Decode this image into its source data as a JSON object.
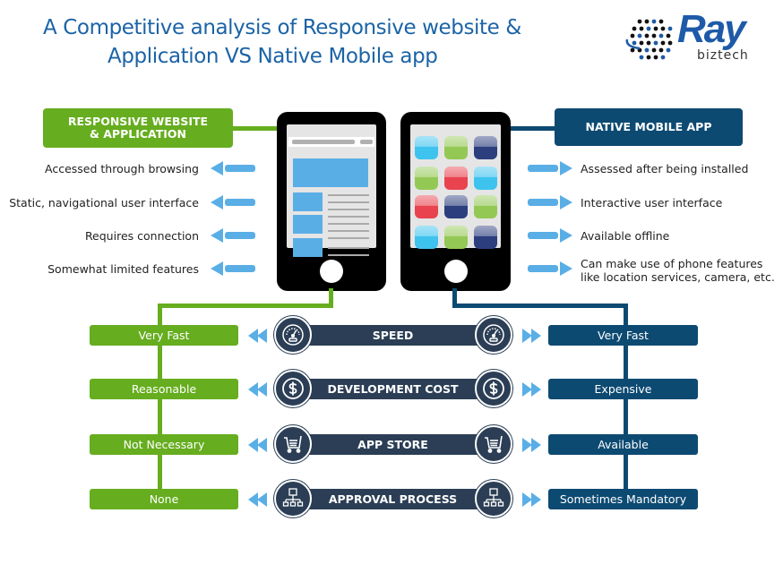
{
  "title": {
    "line1": "A Competitive analysis of Responsive website &",
    "line2": "Application VS Native Mobile app"
  },
  "logo": {
    "brand": "Ray",
    "sub": "biztech"
  },
  "colors": {
    "title": "#1b63a6",
    "responsive_green": "#66ad1f",
    "native_navy": "#0d4a72",
    "criteria_bar": "#2b3e55",
    "arrow_blue": "#5aaee6"
  },
  "left_panel": {
    "header_line1": "RESPONSIVE WEBSITE",
    "header_line2": "& APPLICATION",
    "features": [
      "Accessed through browsing",
      "Static, navigational user interface",
      "Requires connection",
      "Somewhat limited features"
    ]
  },
  "right_panel": {
    "header": "NATIVE MOBILE APP",
    "features": [
      "Assessed after being installed",
      "Interactive user interface",
      "Available offline",
      "Can make use of phone features",
      "like location services, camera, etc."
    ]
  },
  "comparison": [
    {
      "criterion": "SPEED",
      "icon": "speedometer-icon",
      "responsive": "Very Fast",
      "native": "Very Fast"
    },
    {
      "criterion": "DEVELOPMENT COST",
      "icon": "dollar-icon",
      "responsive": "Reasonable",
      "native": "Expensive"
    },
    {
      "criterion": "APP STORE",
      "icon": "shopping-cart-icon",
      "responsive": "Not Necessary",
      "native": "Available"
    },
    {
      "criterion": "APPROVAL PROCESS",
      "icon": "network-hierarchy-icon",
      "responsive": "None",
      "native": "Sometimes Mandatory"
    }
  ]
}
